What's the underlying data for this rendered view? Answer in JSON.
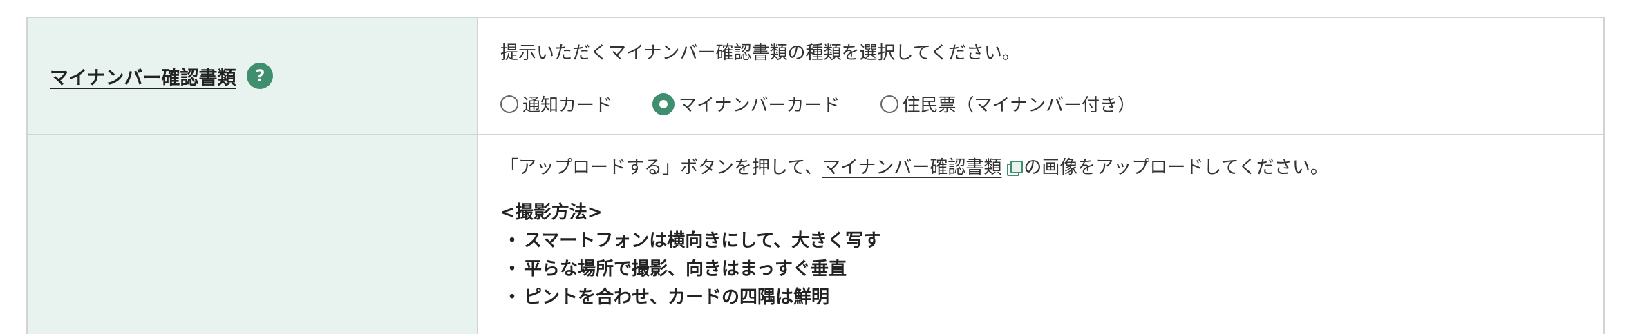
{
  "doc_type_row": {
    "label": "マイナンバー確認書類",
    "help_icon": "?",
    "instruction": "提示いただくマイナンバー確認書類の種類を選択してください。",
    "options": [
      {
        "label": "通知カード",
        "checked": false
      },
      {
        "label": "マイナンバーカード",
        "checked": true
      },
      {
        "label": "住民票（マイナンバー付き）",
        "checked": false
      }
    ]
  },
  "upload_row": {
    "instruction_prefix": "「アップロードする」ボタンを押して、",
    "link_text": "マイナンバー確認書類",
    "link_icon": "external-window-icon",
    "instruction_suffix": "の画像をアップロードしてください。",
    "method_heading": "<撮影方法>",
    "bullet": "・",
    "method_items": [
      "スマートフォンは横向きにして、大きく写す",
      "平らな場所で撮影、向きはまっすぐ垂直",
      "ピントを合わせ、カードの四隅は鮮明"
    ]
  },
  "colors": {
    "accent": "#3f8e6e",
    "label_bg": "#e8f2ee",
    "border": "#cfd5d2"
  }
}
